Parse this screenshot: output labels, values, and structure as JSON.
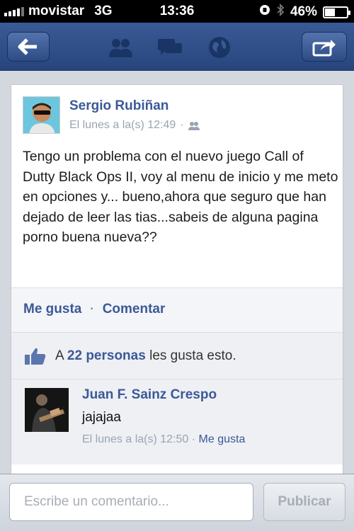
{
  "status_bar": {
    "carrier": "movistar",
    "network": "3G",
    "time": "13:36",
    "battery": "46%",
    "battery_level": 0.46
  },
  "navbar": {
    "icons": [
      "back-arrow-icon",
      "friends-icon",
      "messages-icon",
      "notifications-globe-icon",
      "share-icon"
    ],
    "color": "#3b5998"
  },
  "post": {
    "author": "Sergio Rubiñan",
    "timestamp": "El lunes a la(s) 12:49",
    "separator": "·",
    "text": "Tengo un problema con el nuevo juego Call of Dutty Black Ops II, voy al menu de inicio y me meto en opciones y... bueno,ahora que seguro que han dejado de leer las tias...sabeis de alguna pagina porno buena nueva??",
    "actions": {
      "like": "Me gusta",
      "dot": "·",
      "comment": "Comentar"
    },
    "likes": {
      "prefix": "A",
      "count": "22 personas",
      "suffix": "les gusta esto."
    }
  },
  "comment": {
    "author": "Juan F. Sainz Crespo",
    "text": "jajajaa",
    "timestamp": "El lunes a la(s) 12:50",
    "separator": "·",
    "like": "Me gusta"
  },
  "composer": {
    "placeholder": "Escribe un comentario...",
    "publish_label": "Publicar"
  }
}
